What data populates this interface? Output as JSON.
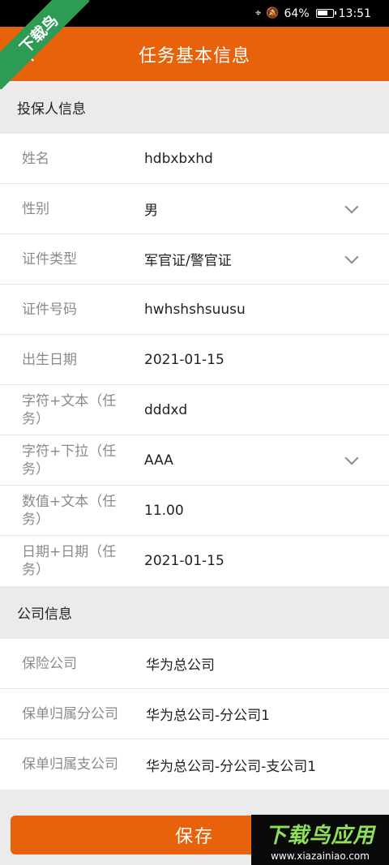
{
  "status_bar": {
    "battery": "64%",
    "time": "13:51"
  },
  "header": {
    "title": "任务基本信息"
  },
  "section_insured": {
    "title": "投保人信息",
    "rows": [
      {
        "label": "姓名",
        "value": "hdbxbxhd",
        "dropdown": false
      },
      {
        "label": "性别",
        "value": "男",
        "dropdown": true
      },
      {
        "label": "证件类型",
        "value": "军官证/警官证",
        "dropdown": true
      },
      {
        "label": "证件号码",
        "value": "hwhshshsuusu",
        "dropdown": false
      },
      {
        "label": "出生日期",
        "value": "2021-01-15",
        "dropdown": false
      },
      {
        "label": "字符+文本（任务）",
        "value": "dddxd",
        "dropdown": false
      },
      {
        "label": "字符+下拉（任务）",
        "value": "AAA",
        "dropdown": true
      },
      {
        "label": "数值+文本（任务）",
        "value": "11.00",
        "dropdown": false
      },
      {
        "label": "日期+日期（任务）",
        "value": "2021-01-15",
        "dropdown": false
      }
    ]
  },
  "section_company": {
    "title": "公司信息",
    "rows": [
      {
        "label": "保险公司",
        "value": "华为总公司"
      },
      {
        "label": "保单归属分公司",
        "value": "华为总公司-分公司1"
      },
      {
        "label": "保单归属支公司",
        "value": "华为总公司-分公司-支公司1"
      }
    ]
  },
  "save_label": "保存",
  "watermark": {
    "corner_text": "下载鸟",
    "brand": "下载鸟应用",
    "url": "www.xiazainiao.com"
  }
}
